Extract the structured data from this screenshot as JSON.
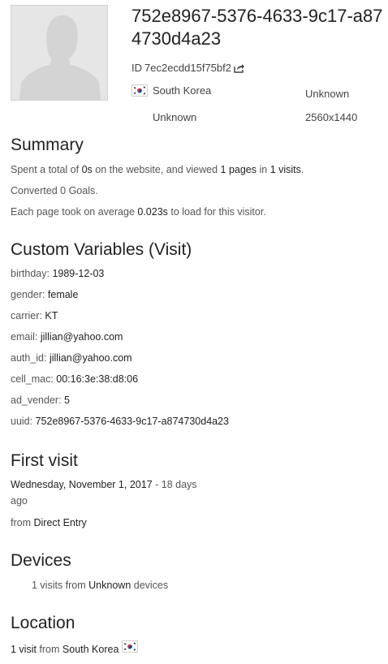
{
  "visitor": {
    "title": "752e8967-5376-4633-9c17-a874730d4a23",
    "id_label": "ID",
    "id_value": "7ec2ecdd15f75bf2",
    "country": "South Korea",
    "browser": "Unknown",
    "os": "Unknown",
    "resolution": "2560x1440"
  },
  "summary": {
    "heading": "Summary",
    "line1": {
      "p1": "Spent a total of ",
      "time": "0s",
      "p2": " on the website, and viewed ",
      "pages": "1 pages",
      "p3": " in ",
      "visits": "1 visits",
      "p4": "."
    },
    "line2": "Converted 0 Goals.",
    "line3": {
      "p1": "Each page took on average ",
      "avg": "0.023s",
      "p2": " to load for this visitor."
    }
  },
  "custom_variables": {
    "heading": "Custom Variables (Visit)",
    "items": [
      {
        "key": "birthday:",
        "value": "1989-12-03"
      },
      {
        "key": "gender:",
        "value": "female"
      },
      {
        "key": "carrier:",
        "value": "KT"
      },
      {
        "key": "email:",
        "value": "jillian@yahoo.com"
      },
      {
        "key": "auth_id:",
        "value": "jillian@yahoo.com"
      },
      {
        "key": "cell_mac:",
        "value": "00:16:3e:38:d8:06"
      },
      {
        "key": "ad_vender:",
        "value": "5"
      },
      {
        "key": "uuid:",
        "value": "752e8967-5376-4633-9c17-a874730d4a23"
      }
    ]
  },
  "first_visit": {
    "heading": "First visit",
    "date": "Wednesday, November 1, 2017",
    "ago_part1": " - 18 days",
    "ago_part2": "ago",
    "from_label": "from ",
    "source": "Direct Entry"
  },
  "devices": {
    "heading": "Devices",
    "p1": "1 visits from ",
    "device": "Unknown",
    "p2": " devices"
  },
  "location": {
    "heading": "Location",
    "visits": "1 visit",
    "from_label": " from ",
    "country": "South Korea"
  },
  "colors": {
    "heading": "#222222",
    "text": "#555555",
    "avatar_bg": "#e8e8e8"
  }
}
